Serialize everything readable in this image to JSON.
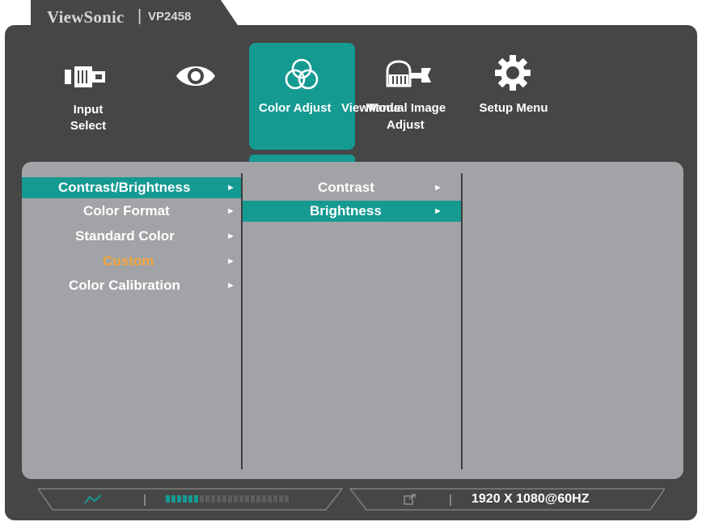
{
  "brand": {
    "name": "ViewSonic",
    "separator": "|",
    "model": "VP2458"
  },
  "tabs": [
    {
      "id": "input-select",
      "label_line1": "Input",
      "label_line2": "Select",
      "icon": "input-connector-icon"
    },
    {
      "id": "viewmode",
      "label_line1": "",
      "label_line2": "",
      "icon": "eye-icon"
    },
    {
      "id": "color-adjust",
      "label_line1": "Color Adjust",
      "label_line2": "",
      "icon": "color-circles-icon",
      "selected": true
    },
    {
      "id": "manual-image-adjust",
      "label_line1": "ViewMode",
      "label_line1b": "Manual Image",
      "label_line2": "Adjust",
      "icon": "hand-wrench-icon"
    },
    {
      "id": "setup-menu",
      "label_line1": "Setup Menu",
      "label_line2": "",
      "icon": "gear-icon"
    }
  ],
  "menu_level1": [
    {
      "label": "Contrast/Brightness",
      "selected": true
    },
    {
      "label": "Color Format"
    },
    {
      "label": "Standard Color"
    },
    {
      "label": "Custom",
      "color": "#f4a43a"
    },
    {
      "label": "Color Calibration"
    }
  ],
  "menu_level2": [
    {
      "label": "Contrast"
    },
    {
      "label": "Brightness",
      "selected": true
    }
  ],
  "arrow_glyph": "►",
  "status": {
    "resolution": "1920 X 1080@60HZ",
    "accent": "#159a92"
  },
  "colors": {
    "frame": "#464646",
    "panel": "#a2a3a6",
    "highlight": "#159a92",
    "custom_text": "#f4a43a"
  }
}
